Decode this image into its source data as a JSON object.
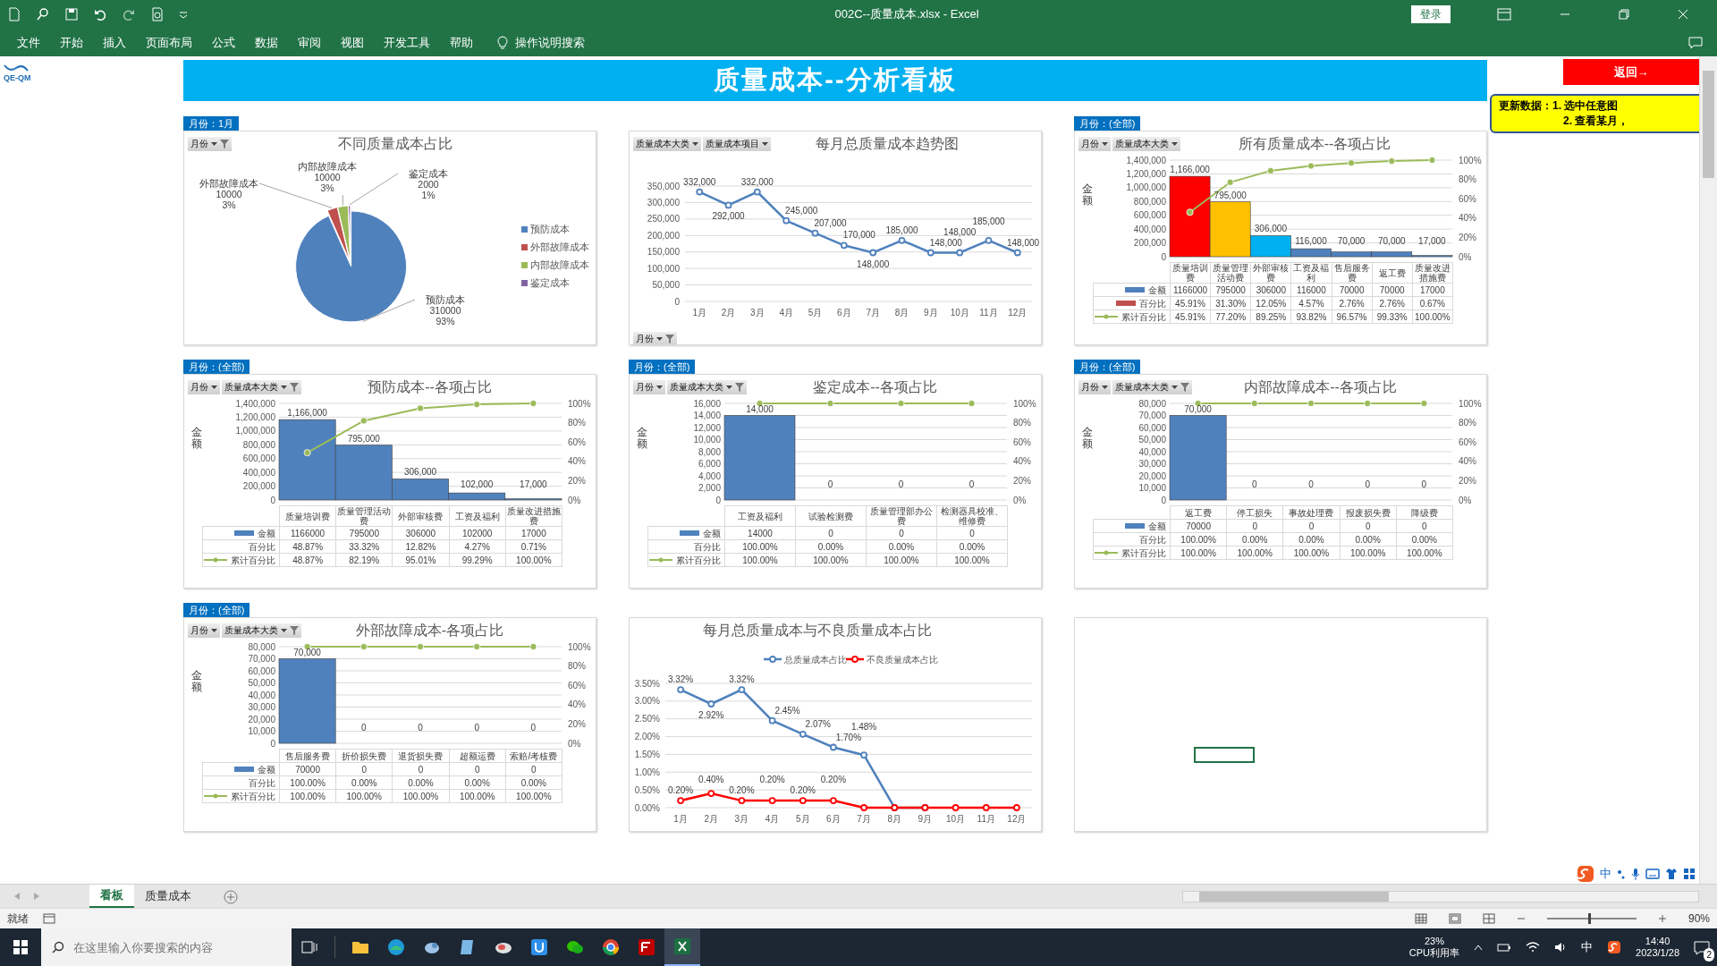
{
  "window": {
    "title": "002C--质量成本.xlsx - Excel",
    "login": "登录"
  },
  "ribbon_tabs": [
    {
      "label": "文件"
    },
    {
      "label": "开始"
    },
    {
      "label": "插入"
    },
    {
      "label": "页面布局"
    },
    {
      "label": "公式"
    },
    {
      "label": "数据"
    },
    {
      "label": "审阅"
    },
    {
      "label": "视图"
    },
    {
      "label": "开发工具"
    },
    {
      "label": "帮助"
    }
  ],
  "tell_me": "操作说明搜索",
  "sheet": {
    "logo": "QE-QM",
    "banner": "质量成本--分析看板",
    "back_button": "返回→",
    "note": [
      "更新数据：1. 选中任意图",
      "2. 查看某月，"
    ],
    "panels": [
      {
        "tag": "月份：1月",
        "title": "不同质量成本占比",
        "filters": [
          {
            "label": "月份",
            "filtered": true
          }
        ],
        "chart_data": {
          "type": "pie",
          "categories": [
            "预防成本",
            "外部故障成本",
            "内部故障成本",
            "鉴定成本"
          ],
          "values": [
            310000,
            10000,
            10000,
            2000
          ],
          "value_labels": [
            "310000",
            "10000",
            "10000",
            "2000"
          ]
        },
        "slice_percents": [
          "93%",
          "3%",
          "3%",
          "1%"
        ],
        "legend_entries": [
          {
            "label": "预防成本",
            "color": "#4f81bd"
          },
          {
            "label": "外部故障成本",
            "color": "#c0504d"
          },
          {
            "label": "内部故障成本",
            "color": "#9bbb59"
          },
          {
            "label": "鉴定成本",
            "color": "#8064a2"
          }
        ]
      },
      {
        "title": "每月总质量成本趋势图",
        "filters": [
          {
            "label": "质量成本大类",
            "filtered": false
          },
          {
            "label": "质量成本项目",
            "filtered": false
          }
        ],
        "axis_filter": {
          "label": "月份",
          "filtered": true
        },
        "chart_data": {
          "type": "line",
          "grid": true,
          "categories": [
            "1月",
            "2月",
            "3月",
            "4月",
            "5月",
            "6月",
            "7月",
            "8月",
            "9月",
            "10月",
            "11月",
            "12月"
          ],
          "series": [
            {
              "color": "#4f81bd",
              "marker": "circle",
              "values": [
                332000,
                292000,
                332000,
                245000,
                207000,
                170000,
                148000,
                185000,
                148000,
                148000,
                185000,
                148000
              ],
              "value_labels": [
                "332,000",
                "292,000",
                "332,000",
                "245,000",
                "207,000",
                "170,000",
                "148,000",
                "185,000",
                "148,000",
                "148,000",
                "185,000",
                "148,000"
              ]
            }
          ],
          "ylim": [
            0,
            350000
          ],
          "yticks": [
            {
              "value": 0,
              "label": "0"
            },
            {
              "value": 50000,
              "label": "50,000"
            },
            {
              "value": 100000,
              "label": "100,000"
            },
            {
              "value": 150000,
              "label": "150,000"
            },
            {
              "value": 200000,
              "label": "200,000"
            },
            {
              "value": 250000,
              "label": "250,000"
            },
            {
              "value": 300000,
              "label": "300,000"
            },
            {
              "value": 350000,
              "label": "350,000"
            }
          ]
        }
      },
      {
        "tag": "月份：(全部)",
        "title": "所有质量成本--各项占比",
        "axis_title": "金额",
        "filters": [
          {
            "label": "月份",
            "filtered": false
          },
          {
            "label": "质量成本大类",
            "filtered": false
          }
        ],
        "chart_data": {
          "type": "bar",
          "grid": true,
          "categories": [
            "质量培训费",
            "质量管理活动费",
            "外部审核费",
            "工资及福利",
            "售后服务费",
            "返工费",
            "质量改进措施费"
          ],
          "series": [
            {
              "colors": [
                "#ff0000",
                "#ffc000",
                "#00b0f0",
                "#4f81bd",
                "#4f81bd",
                "#4f81bd",
                "#4f81bd"
              ],
              "values": [
                1166000,
                795000,
                306000,
                116000,
                70000,
                70000,
                17000
              ],
              "value_labels": [
                "1,166,000",
                "795,000",
                "306,000",
                "116,000",
                "70,000",
                "70,000",
                "17,000"
              ]
            },
            {
              "type": "line",
              "color": "#9bbb59",
              "axis": "y2",
              "marker": "circle",
              "values": [
                46,
                77,
                89,
                94,
                97,
                99,
                100
              ]
            }
          ],
          "ylim": [
            0,
            1400000
          ],
          "y2lim": [
            0,
            100
          ],
          "yticks": [
            {
              "value": 0,
              "label": "0"
            },
            {
              "value": 200000,
              "label": "200,000"
            },
            {
              "value": 400000,
              "label": "400,000"
            },
            {
              "value": 600000,
              "label": "600,000"
            },
            {
              "value": 800000,
              "label": "800,000"
            },
            {
              "value": 1000000,
              "label": "1,000,000"
            },
            {
              "value": 1200000,
              "label": "1,200,000"
            },
            {
              "value": 1400000,
              "label": "1,400,000"
            }
          ],
          "y2ticks": [
            {
              "value": 0,
              "label": "0%"
            },
            {
              "value": 20,
              "label": "20%"
            },
            {
              "value": 40,
              "label": "40%"
            },
            {
              "value": 60,
              "label": "60%"
            },
            {
              "value": 80,
              "label": "80%"
            },
            {
              "value": 100,
              "label": "100%"
            }
          ]
        },
        "table": {
          "rows": [
            {
              "label": "金额",
              "color": "#4f81bd",
              "cells": [
                "1166000",
                "795000",
                "306000",
                "116000",
                "70000",
                "70000",
                "17000"
              ]
            },
            {
              "label": "百分比",
              "color": "#c0504d",
              "cells": [
                "45.91%",
                "31.30%",
                "12.05%",
                "4.57%",
                "2.76%",
                "2.76%",
                "0.67%"
              ]
            },
            {
              "label": "累计百分比",
              "color": "#9bbb59",
              "cells": [
                "45.91%",
                "77.20%",
                "89.25%",
                "93.82%",
                "96.57%",
                "99.33%",
                "100.00%"
              ]
            }
          ]
        }
      },
      {
        "tag": "月份：(全部)",
        "title": "预防成本--各项占比",
        "axis_title": "金额",
        "filters": [
          {
            "label": "月份",
            "filtered": false
          },
          {
            "label": "质量成本大类",
            "filtered": true
          }
        ],
        "chart_data": {
          "type": "bar",
          "grid": true,
          "categories": [
            "质量培训费",
            "质量管理活动费",
            "外部审核费",
            "工资及福利",
            "质量改进措施费"
          ],
          "series": [
            {
              "color": "#4f81bd",
              "values": [
                1166000,
                795000,
                306000,
                102000,
                17000
              ],
              "value_labels": [
                "1,166,000",
                "795,000",
                "306,000",
                "102,000",
                "17,000"
              ]
            },
            {
              "type": "line",
              "color": "#9bbb59",
              "axis": "y2",
              "marker": "circle",
              "values": [
                49,
                82,
                95,
                99,
                100
              ]
            }
          ],
          "ylim": [
            0,
            1400000
          ],
          "y2lim": [
            0,
            100
          ],
          "yticks": [
            {
              "value": 0,
              "label": "0"
            },
            {
              "value": 200000,
              "label": "200,000"
            },
            {
              "value": 400000,
              "label": "400,000"
            },
            {
              "value": 600000,
              "label": "600,000"
            },
            {
              "value": 800000,
              "label": "800,000"
            },
            {
              "value": 1000000,
              "label": "1,000,000"
            },
            {
              "value": 1200000,
              "label": "1,200,000"
            },
            {
              "value": 1400000,
              "label": "1,400,000"
            }
          ],
          "y2ticks": [
            {
              "value": 0,
              "label": "0%"
            },
            {
              "value": 20,
              "label": "20%"
            },
            {
              "value": 40,
              "label": "40%"
            },
            {
              "value": 60,
              "label": "60%"
            },
            {
              "value": 80,
              "label": "80%"
            },
            {
              "value": 100,
              "label": "100%"
            }
          ]
        },
        "table": {
          "rows": [
            {
              "label": "金额",
              "color": "#4f81bd",
              "cells": [
                "1166000",
                "795000",
                "306000",
                "102000",
                "17000"
              ]
            },
            {
              "label": "百分比",
              "cells": [
                "48.87%",
                "33.32%",
                "12.82%",
                "4.27%",
                "0.71%"
              ]
            },
            {
              "label": "累计百分比",
              "color": "#9bbb59",
              "cells": [
                "48.87%",
                "82.19%",
                "95.01%",
                "99.29%",
                "100.00%"
              ]
            }
          ]
        }
      },
      {
        "tag": "月份：(全部)",
        "title": "鉴定成本--各项占比",
        "axis_title": "金额",
        "filters": [
          {
            "label": "月份",
            "filtered": false
          },
          {
            "label": "质量成本大类",
            "filtered": true
          }
        ],
        "chart_data": {
          "type": "bar",
          "grid": true,
          "categories": [
            "工资及福利",
            "试验检测费",
            "质量管理部办公费",
            "检测器具校准、维修费"
          ],
          "series": [
            {
              "color": "#4f81bd",
              "values": [
                14000,
                0,
                0,
                0
              ],
              "value_labels": [
                "14,000",
                "0",
                "0",
                "0"
              ]
            },
            {
              "type": "line",
              "color": "#9bbb59",
              "axis": "y2",
              "marker": "circle",
              "values": [
                100,
                100,
                100,
                100
              ]
            }
          ],
          "ylim": [
            0,
            16000
          ],
          "y2lim": [
            0,
            100
          ],
          "yticks": [
            {
              "value": 0,
              "label": "0"
            },
            {
              "value": 2000,
              "label": "2,000"
            },
            {
              "value": 4000,
              "label": "4,000"
            },
            {
              "value": 6000,
              "label": "6,000"
            },
            {
              "value": 8000,
              "label": "8,000"
            },
            {
              "value": 10000,
              "label": "10,000"
            },
            {
              "value": 12000,
              "label": "12,000"
            },
            {
              "value": 14000,
              "label": "14,000"
            },
            {
              "value": 16000,
              "label": "16,000"
            }
          ],
          "y2ticks": [
            {
              "value": 0,
              "label": "0%"
            },
            {
              "value": 20,
              "label": "20%"
            },
            {
              "value": 40,
              "label": "40%"
            },
            {
              "value": 60,
              "label": "60%"
            },
            {
              "value": 80,
              "label": "80%"
            },
            {
              "value": 100,
              "label": "100%"
            }
          ]
        },
        "table": {
          "rows": [
            {
              "label": "金额",
              "color": "#4f81bd",
              "cells": [
                "14000",
                "0",
                "0",
                "0"
              ]
            },
            {
              "label": "百分比",
              "cells": [
                "100.00%",
                "0.00%",
                "0.00%",
                "0.00%"
              ]
            },
            {
              "label": "累计百分比",
              "color": "#9bbb59",
              "cells": [
                "100.00%",
                "100.00%",
                "100.00%",
                "100.00%"
              ]
            }
          ]
        }
      },
      {
        "tag": "月份：(全部)",
        "title": "内部故障成本--各项占比",
        "axis_title": "金额",
        "filters": [
          {
            "label": "月份",
            "filtered": false
          },
          {
            "label": "质量成本大类",
            "filtered": true
          }
        ],
        "chart_data": {
          "type": "bar",
          "grid": true,
          "categories": [
            "返工费",
            "停工损失",
            "事故处理费",
            "报废损失费",
            "降级费"
          ],
          "series": [
            {
              "color": "#4f81bd",
              "values": [
                70000,
                0,
                0,
                0,
                0
              ],
              "value_labels": [
                "70,000",
                "0",
                "0",
                "0",
                "0"
              ]
            },
            {
              "type": "line",
              "color": "#9bbb59",
              "axis": "y2",
              "marker": "circle",
              "values": [
                100,
                100,
                100,
                100,
                100
              ]
            }
          ],
          "ylim": [
            0,
            80000
          ],
          "y2lim": [
            0,
            100
          ],
          "yticks": [
            {
              "value": 0,
              "label": "0"
            },
            {
              "value": 10000,
              "label": "10,000"
            },
            {
              "value": 20000,
              "label": "20,000"
            },
            {
              "value": 30000,
              "label": "30,000"
            },
            {
              "value": 40000,
              "label": "40,000"
            },
            {
              "value": 50000,
              "label": "50,000"
            },
            {
              "value": 60000,
              "label": "60,000"
            },
            {
              "value": 70000,
              "label": "70,000"
            },
            {
              "value": 80000,
              "label": "80,000"
            }
          ],
          "y2ticks": [
            {
              "value": 0,
              "label": "0%"
            },
            {
              "value": 20,
              "label": "20%"
            },
            {
              "value": 40,
              "label": "40%"
            },
            {
              "value": 60,
              "label": "60%"
            },
            {
              "value": 80,
              "label": "80%"
            },
            {
              "value": 100,
              "label": "100%"
            }
          ]
        },
        "table": {
          "rows": [
            {
              "label": "金额",
              "color": "#4f81bd",
              "cells": [
                "70000",
                "0",
                "0",
                "0",
                "0"
              ]
            },
            {
              "label": "百分比",
              "cells": [
                "100.00%",
                "0.00%",
                "0.00%",
                "0.00%",
                "0.00%"
              ]
            },
            {
              "label": "累计百分比",
              "color": "#9bbb59",
              "cells": [
                "100.00%",
                "100.00%",
                "100.00%",
                "100.00%",
                "100.00%"
              ]
            }
          ]
        }
      },
      {
        "tag": "月份：(全部)",
        "title": "外部故障成本-各项占比",
        "axis_title": "金额",
        "filters": [
          {
            "label": "月份",
            "filtered": false
          },
          {
            "label": "质量成本大类",
            "filtered": true
          }
        ],
        "chart_data": {
          "type": "bar",
          "grid": true,
          "categories": [
            "售后服务费",
            "折价损失费",
            "退货损失费",
            "超额运费",
            "索赔/考核费"
          ],
          "series": [
            {
              "color": "#4f81bd",
              "values": [
                70000,
                0,
                0,
                0,
                0
              ],
              "value_labels": [
                "70,000",
                "0",
                "0",
                "0",
                "0"
              ]
            },
            {
              "type": "line",
              "color": "#9bbb59",
              "axis": "y2",
              "marker": "circle",
              "values": [
                100,
                100,
                100,
                100,
                100
              ]
            }
          ],
          "ylim": [
            0,
            80000
          ],
          "y2lim": [
            0,
            100
          ],
          "yticks": [
            {
              "value": 0,
              "label": "0"
            },
            {
              "value": 10000,
              "label": "10,000"
            },
            {
              "value": 20000,
              "label": "20,000"
            },
            {
              "value": 30000,
              "label": "30,000"
            },
            {
              "value": 40000,
              "label": "40,000"
            },
            {
              "value": 50000,
              "label": "50,000"
            },
            {
              "value": 60000,
              "label": "60,000"
            },
            {
              "value": 70000,
              "label": "70,000"
            },
            {
              "value": 80000,
              "label": "80,000"
            }
          ],
          "y2ticks": [
            {
              "value": 0,
              "label": "0%"
            },
            {
              "value": 20,
              "label": "20%"
            },
            {
              "value": 40,
              "label": "40%"
            },
            {
              "value": 60,
              "label": "60%"
            },
            {
              "value": 80,
              "label": "80%"
            },
            {
              "value": 100,
              "label": "100%"
            }
          ]
        },
        "table": {
          "rows": [
            {
              "label": "金额",
              "color": "#4f81bd",
              "cells": [
                "70000",
                "0",
                "0",
                "0",
                "0"
              ]
            },
            {
              "label": "百分比",
              "cells": [
                "100.00%",
                "0.00%",
                "0.00%",
                "0.00%",
                "0.00%"
              ]
            },
            {
              "label": "累计百分比",
              "color": "#9bbb59",
              "cells": [
                "100.00%",
                "100.00%",
                "100.00%",
                "100.00%",
                "100.00%"
              ]
            }
          ]
        }
      },
      {
        "title": "每月总质量成本与不良质量成本占比",
        "chart_data": {
          "type": "line",
          "grid": true,
          "legend": "top",
          "categories": [
            "1月",
            "2月",
            "3月",
            "4月",
            "5月",
            "6月",
            "7月",
            "8月",
            "9月",
            "10月",
            "11月",
            "12月"
          ],
          "series": [
            {
              "name": "总质量成本占比",
              "color": "#4f81bd",
              "marker": "circle",
              "values": [
                3.32,
                2.92,
                3.32,
                2.45,
                2.07,
                1.7,
                1.48,
                0,
                0,
                null,
                null,
                null
              ],
              "value_labels": [
                "3.32%",
                "2.92%",
                "3.32%",
                "2.45%",
                "2.07%",
                "1.70%",
                "1.48%",
                null,
                null,
                null,
                null,
                null
              ]
            },
            {
              "name": "不良质量成本占比",
              "color": "#ff0000",
              "marker": "circle",
              "values": [
                0.2,
                0.4,
                0.2,
                0.2,
                0.2,
                0.2,
                0,
                0,
                0,
                0,
                0,
                0
              ],
              "value_labels": [
                "0.20%",
                "0.40%",
                "0.20%",
                "0.20%",
                "0.20%",
                "0.20%",
                null,
                null,
                null,
                null,
                null,
                null
              ]
            }
          ],
          "ylim": [
            0,
            3.5
          ],
          "yticks": [
            {
              "value": 0,
              "label": "0.00%"
            },
            {
              "value": 0.5,
              "label": "0.50%"
            },
            {
              "value": 1,
              "label": "1.00%"
            },
            {
              "value": 1.5,
              "label": "1.50%"
            },
            {
              "value": 2,
              "label": "2.00%"
            },
            {
              "value": 2.5,
              "label": "2.50%"
            },
            {
              "value": 3,
              "label": "3.00%"
            },
            {
              "value": 3.5,
              "label": "3.50%"
            }
          ]
        }
      },
      {
        "selected_cell": true
      }
    ]
  },
  "sheet_tabs": [
    {
      "label": "看板",
      "selected": true
    },
    {
      "label": "质量成本",
      "selected": false
    }
  ],
  "ime": {
    "mode": "中"
  },
  "status_bar": {
    "status": "就绪",
    "zoom": "90%",
    "zoom_slider": {
      "level": 0.47
    }
  },
  "taskbar": {
    "search_placeholder": "在这里输入你要搜索的内容",
    "apps": [
      {
        "selected": false
      },
      {
        "selected": false
      },
      {
        "selected": false
      },
      {
        "selected": false
      },
      {
        "selected": false
      },
      {
        "selected": false
      },
      {
        "selected": false
      },
      {
        "selected": false
      },
      {
        "selected": false
      },
      {
        "selected": true
      }
    ],
    "cpu": "23%",
    "cpu_label": "CPU利用率",
    "ime": "中",
    "time": "14:40",
    "date": "2023/1/28",
    "notifications": "2"
  }
}
